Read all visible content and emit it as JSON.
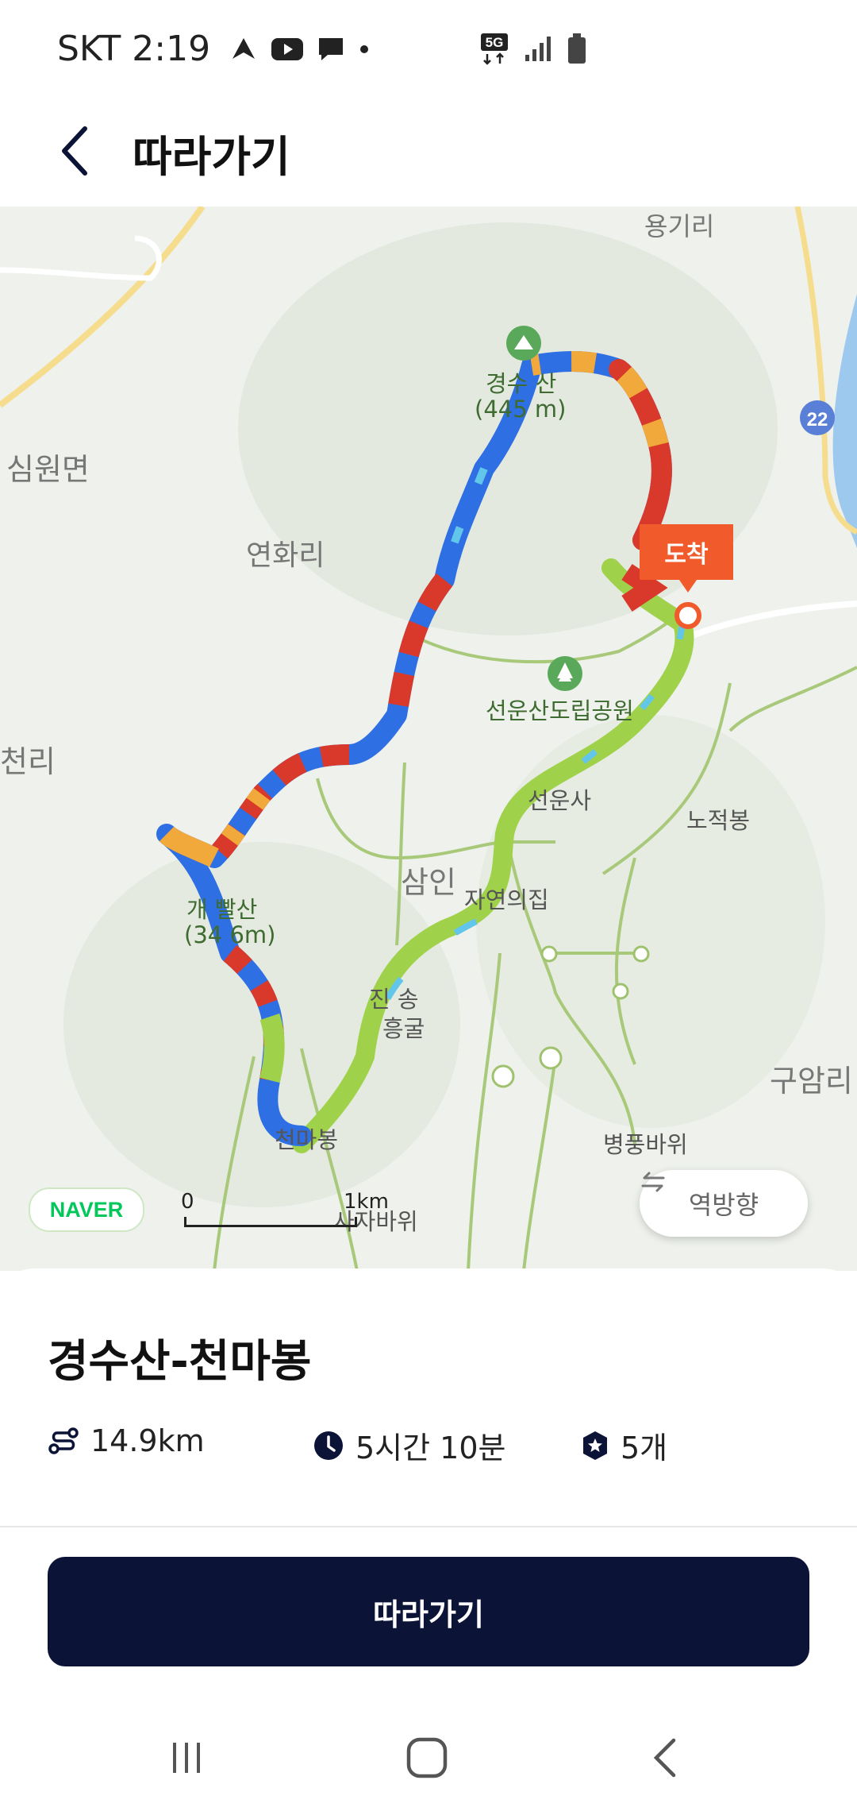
{
  "status_bar": {
    "carrier": "SKT",
    "time": "2:19",
    "network": "5G",
    "left_icons": [
      "nav-arrow-icon",
      "youtube-icon",
      "chat-icon",
      "dot-icon"
    ],
    "right_icons": [
      "5g-icon",
      "signal-icon",
      "battery-icon"
    ]
  },
  "header": {
    "back_icon": "chevron-left-icon",
    "title": "따라가기"
  },
  "map": {
    "labels": {
      "simwon": "심원면",
      "yeonhwa": "연화리",
      "cheon": "천리",
      "gyeongsu_peak_a": "경수",
      "gyeongsu_peak_b": "산",
      "gyeongsu_elev_a": "(445",
      "gyeongsu_elev_b": "m)",
      "gaeppal_a": "개",
      "gaeppal_b": "빨산",
      "gaeppal_elev_a": "(34",
      "gaeppal_elev_b": "6m)",
      "park": "선운산도립공원",
      "seonunsa": "선운사",
      "nojeok": "노적봉",
      "sami": "삼인",
      "jayeon": "자연의집",
      "jinheung_a": "진",
      "jinheung_b": "송",
      "donggul": "흥굴",
      "cheonma": "천마봉",
      "byeongpung": "병풍바위",
      "guam": "구암리",
      "saja": "사자바위",
      "top_village": "용기리",
      "road_number": "22"
    },
    "arrive_label": "도착",
    "provider": "NAVER",
    "scale": {
      "zero": "0",
      "distance": "1km"
    },
    "reverse_button": {
      "icon": "swap-arrows-icon",
      "label": "역방향"
    },
    "colors": {
      "route_blue": "#2f6fe4",
      "route_red": "#d8392a",
      "route_orange": "#f2a93b",
      "route_green": "#9fd24a",
      "route_cyan": "#61c6ea",
      "trail": "#9ec26d",
      "arrive": "#f15a2a"
    }
  },
  "course": {
    "title": "경수산-천마봉",
    "distance": {
      "icon": "route-icon",
      "value": "14.9km"
    },
    "duration": {
      "icon": "clock-icon",
      "value": "5시간 10분"
    },
    "checkpoints": {
      "icon": "badge-star-icon",
      "value": "5개"
    }
  },
  "follow_button": {
    "label": "따라가기",
    "color": "#0b1336"
  },
  "nav_bar": {
    "recents_icon": "recents-icon",
    "home_icon": "home-icon",
    "back_icon": "back-icon"
  }
}
